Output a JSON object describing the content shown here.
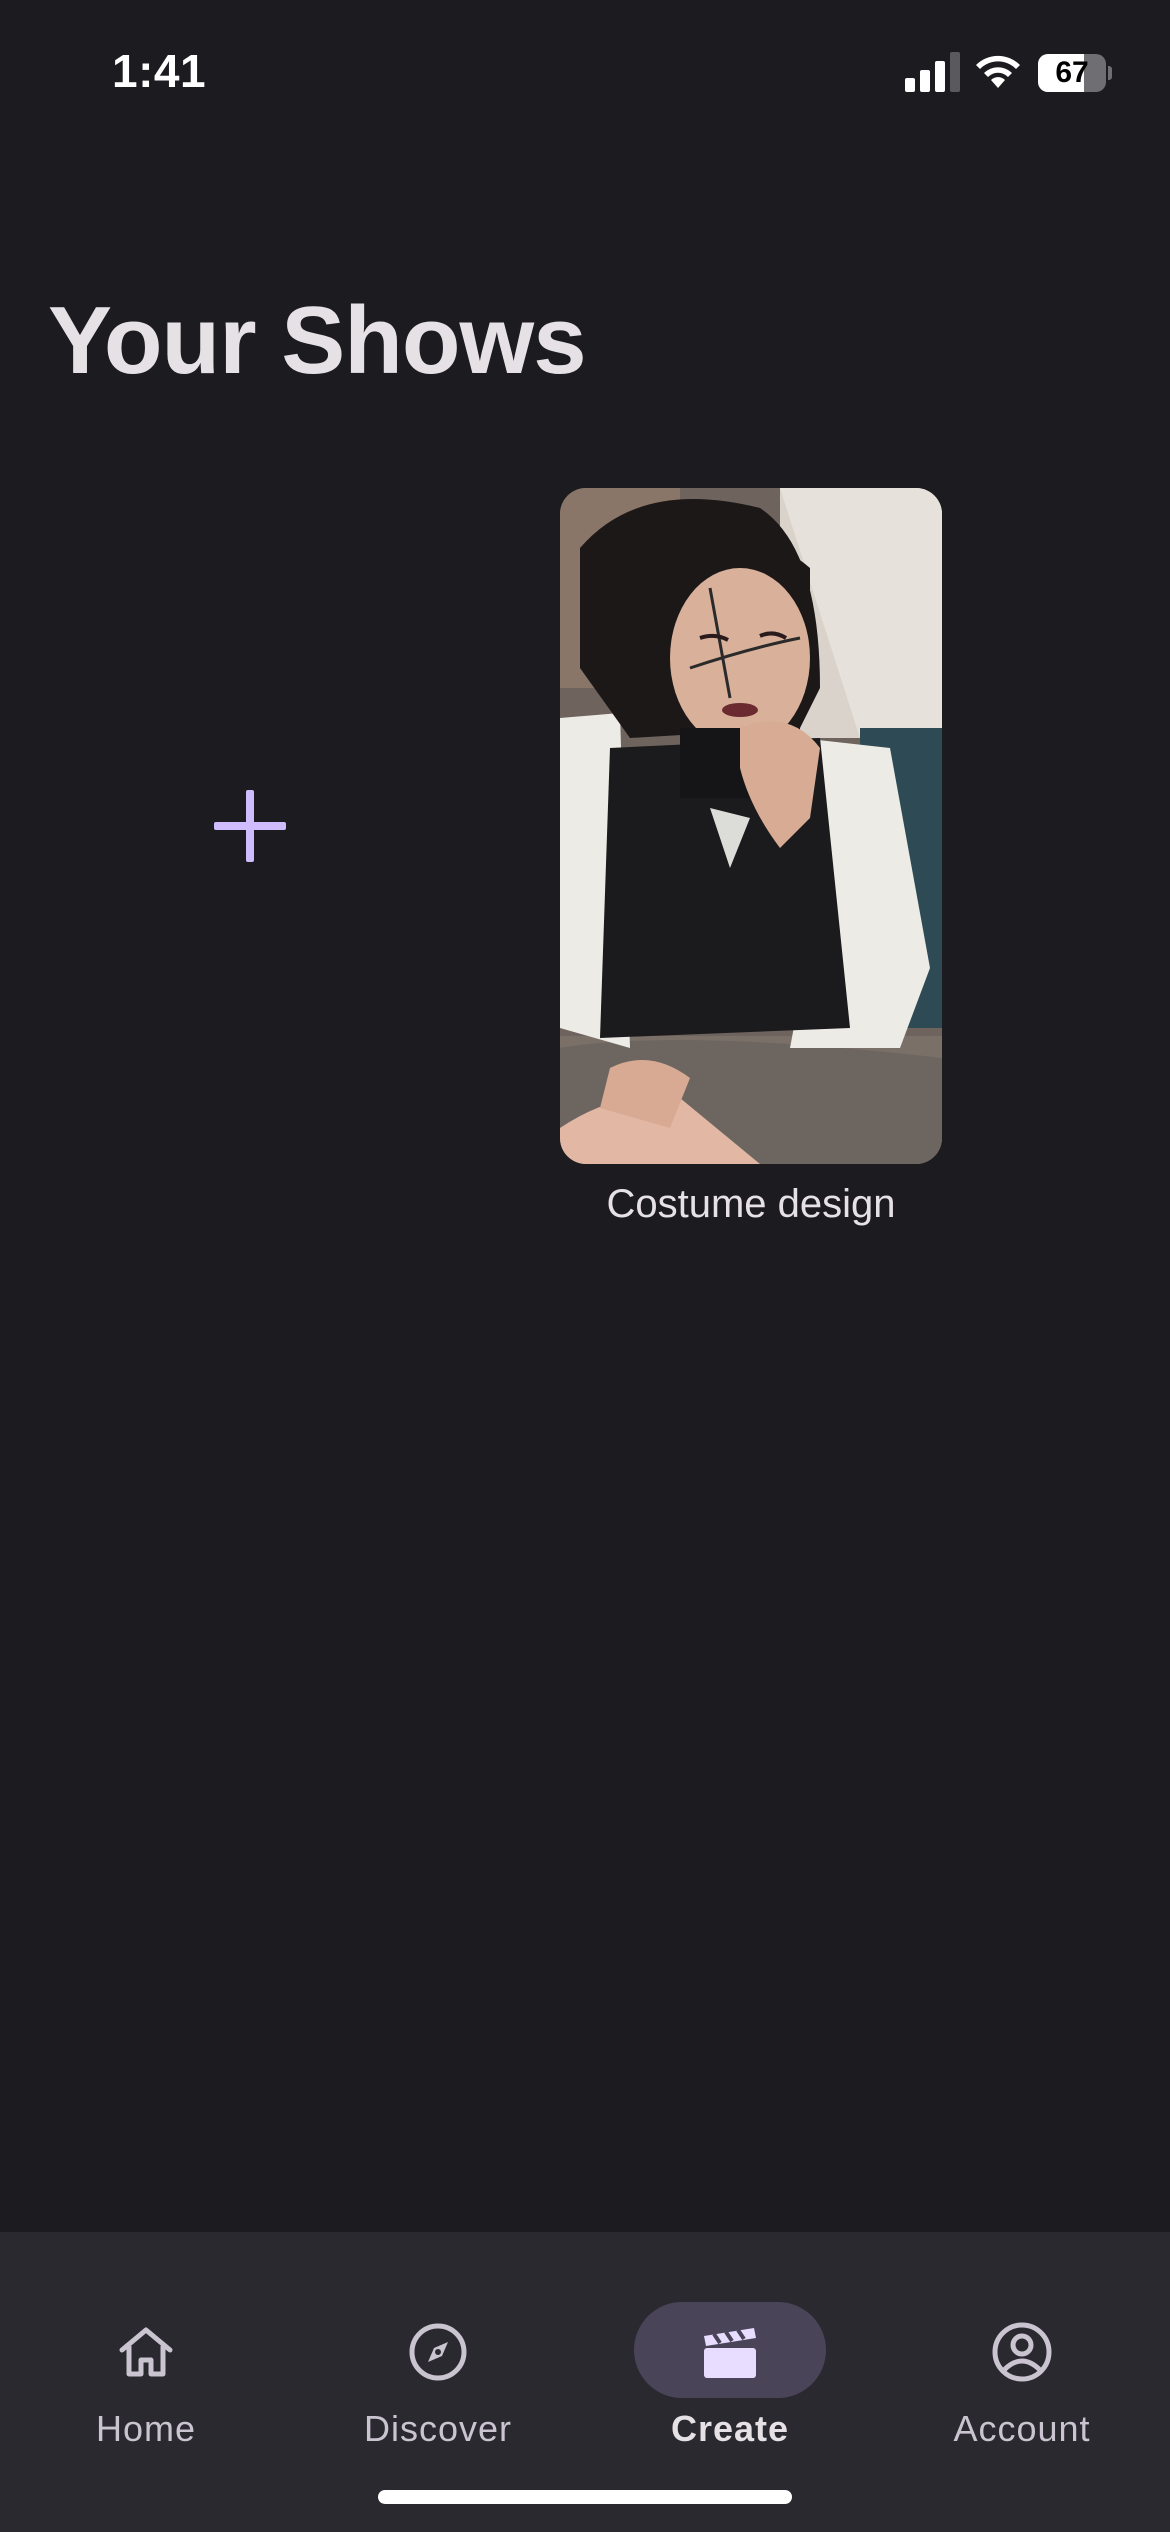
{
  "status_bar": {
    "time": "1:41",
    "battery_level": "67",
    "battery_fraction": 0.67,
    "signal_icon": "cellular-signal-icon",
    "wifi_icon": "wifi-icon"
  },
  "page": {
    "title": "Your Shows"
  },
  "add_show": {
    "icon": "plus-icon",
    "color": "#cfbcff"
  },
  "shows": [
    {
      "title": "Costume design",
      "thumbnail": "photo of person with face markings"
    }
  ],
  "nav": {
    "items": [
      {
        "label": "Home",
        "icon": "home-icon",
        "active": false
      },
      {
        "label": "Discover",
        "icon": "compass-icon",
        "active": false
      },
      {
        "label": "Create",
        "icon": "clapperboard-icon",
        "active": true
      },
      {
        "label": "Account",
        "icon": "account-circle-icon",
        "active": false
      }
    ]
  },
  "colors": {
    "background": "#1c1b1f",
    "nav_background": "#2b2930",
    "active_pill": "#4a4458",
    "accent": "#cfbcff"
  }
}
